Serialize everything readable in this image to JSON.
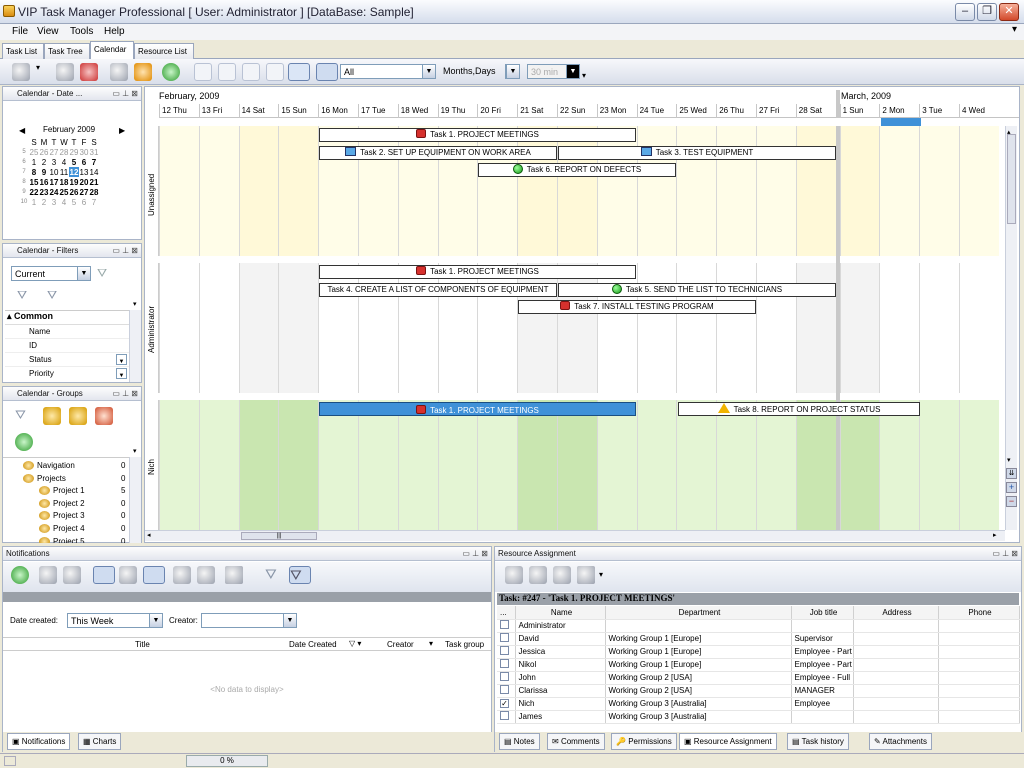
{
  "window": {
    "title": "VIP Task Manager Professional [ User: Administrator ] [DataBase: Sample]"
  },
  "menu": [
    "File",
    "View",
    "Tools",
    "Help"
  ],
  "view_tabs": [
    "Task List",
    "Task Tree",
    "Calendar",
    "Resource List"
  ],
  "toolbar": {
    "filter_value": "All",
    "scale_value": "Months,Days",
    "interval_value": "30 min"
  },
  "left_panels": {
    "calendar_date": {
      "title": "Calendar - Date ...",
      "month": "February 2009",
      "weekdays": [
        "S",
        "M",
        "T",
        "W",
        "T",
        "F",
        "S"
      ],
      "weeks": [
        {
          "num": "5",
          "days": [
            "25",
            "26",
            "27",
            "28",
            "29",
            "30",
            "31"
          ]
        },
        {
          "num": "6",
          "days": [
            "1",
            "2",
            "3",
            "4",
            "5",
            "6",
            "7"
          ]
        },
        {
          "num": "7",
          "days": [
            "8",
            "9",
            "10",
            "11",
            "12",
            "13",
            "14"
          ]
        },
        {
          "num": "8",
          "days": [
            "15",
            "16",
            "17",
            "18",
            "19",
            "20",
            "21"
          ]
        },
        {
          "num": "9",
          "days": [
            "22",
            "23",
            "24",
            "25",
            "26",
            "27",
            "28"
          ]
        },
        {
          "num": "10",
          "days": [
            "1",
            "2",
            "3",
            "4",
            "5",
            "6",
            "7"
          ]
        }
      ],
      "selected_day": "12"
    },
    "calendar_filters": {
      "title": "Calendar - Filters",
      "current": "Current",
      "group": "Common",
      "fields": [
        "Name",
        "ID",
        "Status",
        "Priority"
      ]
    },
    "calendar_groups": {
      "title": "Calendar - Groups",
      "items": [
        {
          "label": "Navigation",
          "count": "0"
        },
        {
          "label": "Projects",
          "count": "0"
        },
        {
          "label": "Project 1",
          "count": "5"
        },
        {
          "label": "Project 2",
          "count": "0"
        },
        {
          "label": "Project 3",
          "count": "0"
        },
        {
          "label": "Project 4",
          "count": "0"
        },
        {
          "label": "Project 5",
          "count": "0"
        }
      ]
    }
  },
  "calendar": {
    "month_feb": "February, 2009",
    "month_mar": "March, 2009",
    "days": [
      "12 Thu",
      "13 Fri",
      "14 Sat",
      "15 Sun",
      "16 Mon",
      "17 Tue",
      "18 Wed",
      "19 Thu",
      "20 Fri",
      "21 Sat",
      "22 Sun",
      "23 Mon",
      "24 Tue",
      "25 Wed",
      "26 Thu",
      "27 Fri",
      "28 Sat",
      "1 Sun",
      "2 Mon",
      "3 Tue",
      "4 Wed"
    ],
    "groups": [
      "Unassigned",
      "Administrator",
      "Nich"
    ],
    "tasks": {
      "u1": "Task 1. PROJECT MEETINGS",
      "u2": "Task 2. SET UP EQUIPMENT ON WORK AREA",
      "u3": "Task 3. TEST EQUIPMENT",
      "u6": "Task 6. REPORT ON DEFECTS",
      "a1": "Task 1. PROJECT MEETINGS",
      "a4": "Task 4. CREATE A LIST OF COMPONENTS OF EQUIPMENT",
      "a5": "Task 5. SEND THE LIST TO TECHNICIANS",
      "a7": "Task 7. INSTALL TESTING PROGRAM",
      "n1": "Task 1. PROJECT MEETINGS",
      "n8": "Task 8. REPORT ON PROJECT STATUS"
    }
  },
  "notifications": {
    "title": "Notifications",
    "date_created_label": "Date created:",
    "date_created_value": "This Week",
    "creator_label": "Creator:",
    "columns": [
      "Title",
      "Date Created",
      "Creator",
      "Task group"
    ],
    "empty_text": "<No data to display>",
    "tabs": [
      "Notifications",
      "Charts"
    ]
  },
  "resource": {
    "title": "Resource Assignment",
    "task_header": "Task: #247 - 'Task 1. PROJECT MEETINGS'",
    "columns": [
      "...",
      "Name",
      "Department",
      "Job title",
      "Address",
      "Phone"
    ],
    "rows": [
      {
        "checked": false,
        "name": "Administrator",
        "dept": "",
        "job": ""
      },
      {
        "checked": false,
        "name": "David",
        "dept": "Working Group 1 [Europe]",
        "job": "Supervisor"
      },
      {
        "checked": false,
        "name": "Jessica",
        "dept": "Working Group 1 [Europe]",
        "job": "Employee - Part"
      },
      {
        "checked": false,
        "name": "Nikol",
        "dept": "Working Group 1 [Europe]",
        "job": "Employee - Part"
      },
      {
        "checked": false,
        "name": "John",
        "dept": "Working Group 2 [USA]",
        "job": "Employee - Full"
      },
      {
        "checked": false,
        "name": "Clarissa",
        "dept": "Working Group 2 [USA]",
        "job": "MANAGER"
      },
      {
        "checked": true,
        "name": "Nich",
        "dept": "Working Group 3 [Australia]",
        "job": "Employee"
      },
      {
        "checked": false,
        "name": "James",
        "dept": "Working Group 3 [Australia]",
        "job": ""
      }
    ],
    "tabs": [
      "Notes",
      "Comments",
      "Permissions",
      "Resource Assignment",
      "Task history",
      "Attachments"
    ]
  },
  "status": {
    "progress": "0 %"
  }
}
